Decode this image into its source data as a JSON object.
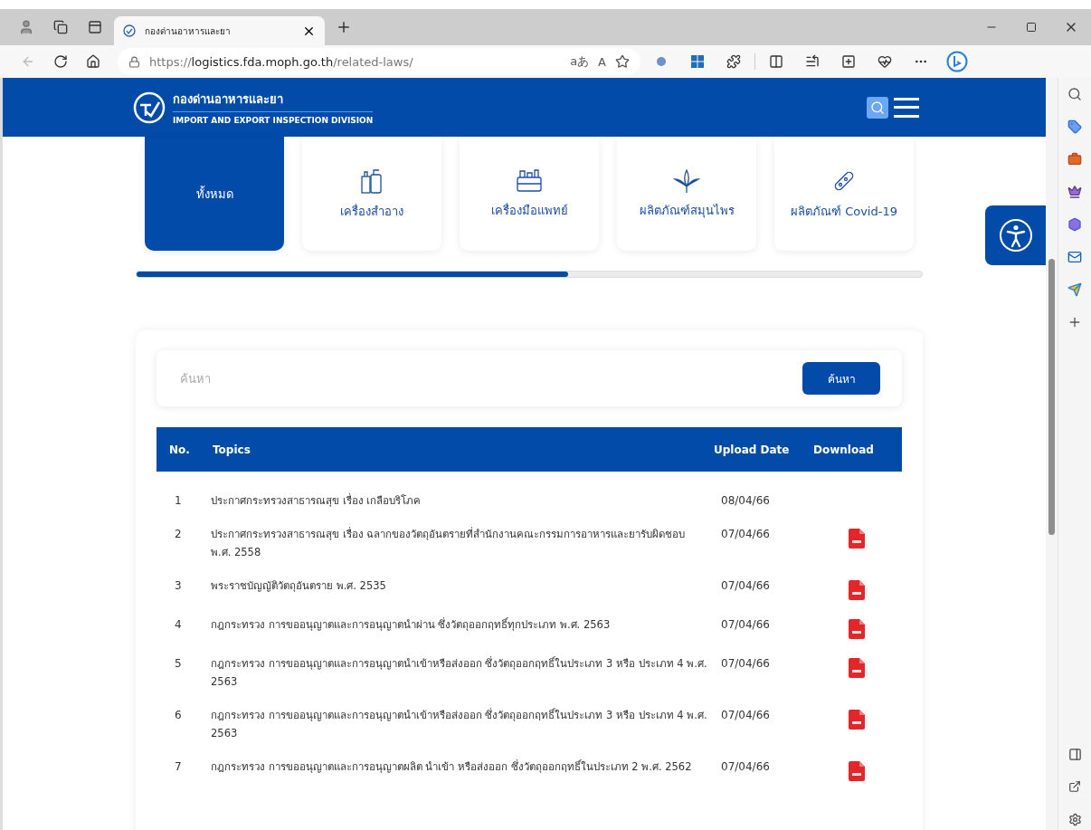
{
  "browser": {
    "tab_title": "กองด่านอาหารและยา",
    "url_scheme": "https://",
    "url_host": "logistics.fda.moph.go.th",
    "url_path": "/related-laws/",
    "translate_label": "aあ",
    "read_aloud_label": "A"
  },
  "header": {
    "site_name": "กองด่านอาหารและยา",
    "site_subtitle": "IMPORT AND EXPORT INSPECTION DIVISION"
  },
  "categories": [
    {
      "label": "ทั้งหมด",
      "kind": "all",
      "selected": true
    },
    {
      "label": "เครื่องสำอาง",
      "kind": "cosmetics",
      "selected": false
    },
    {
      "label": "เครื่องมือแพทย์",
      "kind": "medical",
      "selected": false
    },
    {
      "label": "ผลิตภัณฑ์สมุนไพร",
      "kind": "herbal",
      "selected": false
    },
    {
      "label": "ผลิตภัณฑ์ Covid-19",
      "kind": "covid",
      "selected": false
    }
  ],
  "search": {
    "placeholder": "ค้นหา",
    "button": "ค้นหา"
  },
  "table": {
    "columns": [
      "No.",
      "Topics",
      "Upload Date",
      "Download"
    ],
    "rows": [
      {
        "no": "1",
        "topic": "ประกาศกระทรวงสาธารณสุข เรื่อง เกลือบริโภค",
        "date": "08/04/66",
        "pdf": false
      },
      {
        "no": "2",
        "topic": "ประกาศกระทรวงสาธารณสุข เรื่อง ฉลากของวัตถุอันตรายที่สำนักงานคณะกรรมการอาหารและยารับผิดชอบ พ.ศ. 2558",
        "date": "07/04/66",
        "pdf": true
      },
      {
        "no": "3",
        "topic": "พระราชบัญญัติวัตถุอันตราย พ.ศ. 2535",
        "date": "07/04/66",
        "pdf": true
      },
      {
        "no": "4",
        "topic": "กฎกระทรวง การขออนุญาตและการอนุญาตนำผ่าน ซึ่งวัตถุออกฤทธิ์ทุกประเภท พ.ศ. 2563",
        "date": "07/04/66",
        "pdf": true
      },
      {
        "no": "5",
        "topic": "กฎกระทรวง การขออนุญาตและการอนุญาตนำเข้าหรือส่งออก ซึ่งวัตถุออกฤทธิ์ในประเภท 3 หรือ ประเภท 4 พ.ศ. 2563",
        "date": "07/04/66",
        "pdf": true
      },
      {
        "no": "6",
        "topic": "กฎกระทรวง การขออนุญาตและการอนุญาตนำเข้าหรือส่งออก ซึ่งวัตถุออกฤทธิ์ในประเภท 3 หรือ ประเภท 4 พ.ศ. 2563",
        "date": "07/04/66",
        "pdf": true
      },
      {
        "no": "7",
        "topic": "กฎกระทรวง การขออนุญาตและการอนุญาตผลิต นำเข้า หรือส่งออก ซึ่งวัตถุออกฤทธิ์ในประเภท 2 พ.ศ. 2562",
        "date": "07/04/66",
        "pdf": true
      }
    ]
  }
}
